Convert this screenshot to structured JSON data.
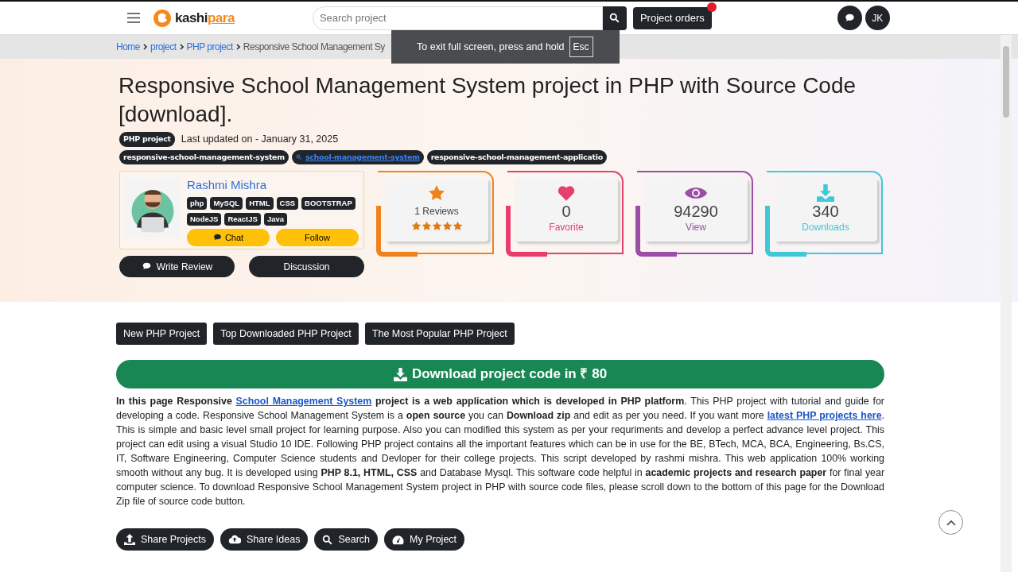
{
  "navbar": {
    "logo": [
      "kashi",
      "para"
    ],
    "search": {
      "placeholder": "Search project"
    },
    "orders_button": "Project orders",
    "orders_alert": true,
    "user_initials": "JK"
  },
  "breadcrumb": [
    "Home",
    "project",
    "PHP project",
    "Responsive School Management Sy"
  ],
  "fullscreen_notice": {
    "text": "To exit full screen, press and hold",
    "key": "Esc"
  },
  "title": "Responsive School Management System project in PHP with Source Code [download].",
  "category_badge": "PHP project",
  "updated": "Last updated on - January 31, 2025",
  "tags": [
    {
      "kind": "plain",
      "text": "responsive-school-management-system"
    },
    {
      "kind": "link",
      "text": "school-management-system"
    },
    {
      "kind": "plain",
      "text": "responsive-school-management-applicatio"
    }
  ],
  "author": {
    "name": "Rashmi Mishra",
    "skills": [
      "php",
      "MySQL",
      "HTML",
      "CSS",
      "BOOTSTRAP",
      "NodeJS",
      "ReactJS",
      "Java"
    ],
    "chat": "Chat",
    "follow": "Follow"
  },
  "actions": [
    "Write Review",
    "Discussion"
  ],
  "stats": [
    {
      "kind": "reviews",
      "color": "#f0821e",
      "value": "1 Reviews",
      "stars": 5
    },
    {
      "kind": "count",
      "color": "#e83e6c",
      "value": "0",
      "label": "Favorite"
    },
    {
      "kind": "count",
      "color": "#9b4ea6",
      "value": "94290",
      "label": "View"
    },
    {
      "kind": "count",
      "color": "#3fc8d6",
      "value": "340",
      "label": "Downloads"
    }
  ],
  "category_buttons": [
    "New PHP Project",
    "Top Downloaded PHP Project",
    "The Most Popular PHP Project"
  ],
  "download_button": "Download project code in ₹ 80",
  "description": [
    {
      "kind": "text",
      "text": "**In this page Responsive** "
    },
    {
      "kind": "link",
      "text": "School Management System"
    },
    {
      "kind": "text",
      "text": " **project is a web application which is developed in PHP platform**. This PHP project with tutorial and guide for developing a code. Responsive School Management System is a **open source** you can **Download zip** and edit as per you need. If you want more "
    },
    {
      "kind": "link",
      "text": "latest PHP projects here"
    },
    {
      "kind": "text",
      "text": ". This is simple and basic level small project for learning purpose. Also you can modified this system as per your requriments and develop a perfect advance level project. This project can edit using a visual Studio 10 IDE. Following PHP project contains all the important features which can be in use for the BE, BTech, MCA, BCA, Engineering, Bs.CS, IT, Software Engineering, Computer Science students and Devloper for their college projects. This script developed by rashmi mishra. This web application 100% working smooth without any bug. It is developed using **PHP 8.1, HTML, CSS** and Database Mysql. This software code helpful in **academic projects and research paper** for final year computer science. To download Responsive School Management System project in PHP with source code files, please scroll down to the bottom of this page for the Download Zip file of source code button."
    }
  ],
  "share_buttons": [
    "Share Projects",
    "Share Ideas",
    "Search",
    "My Project"
  ]
}
